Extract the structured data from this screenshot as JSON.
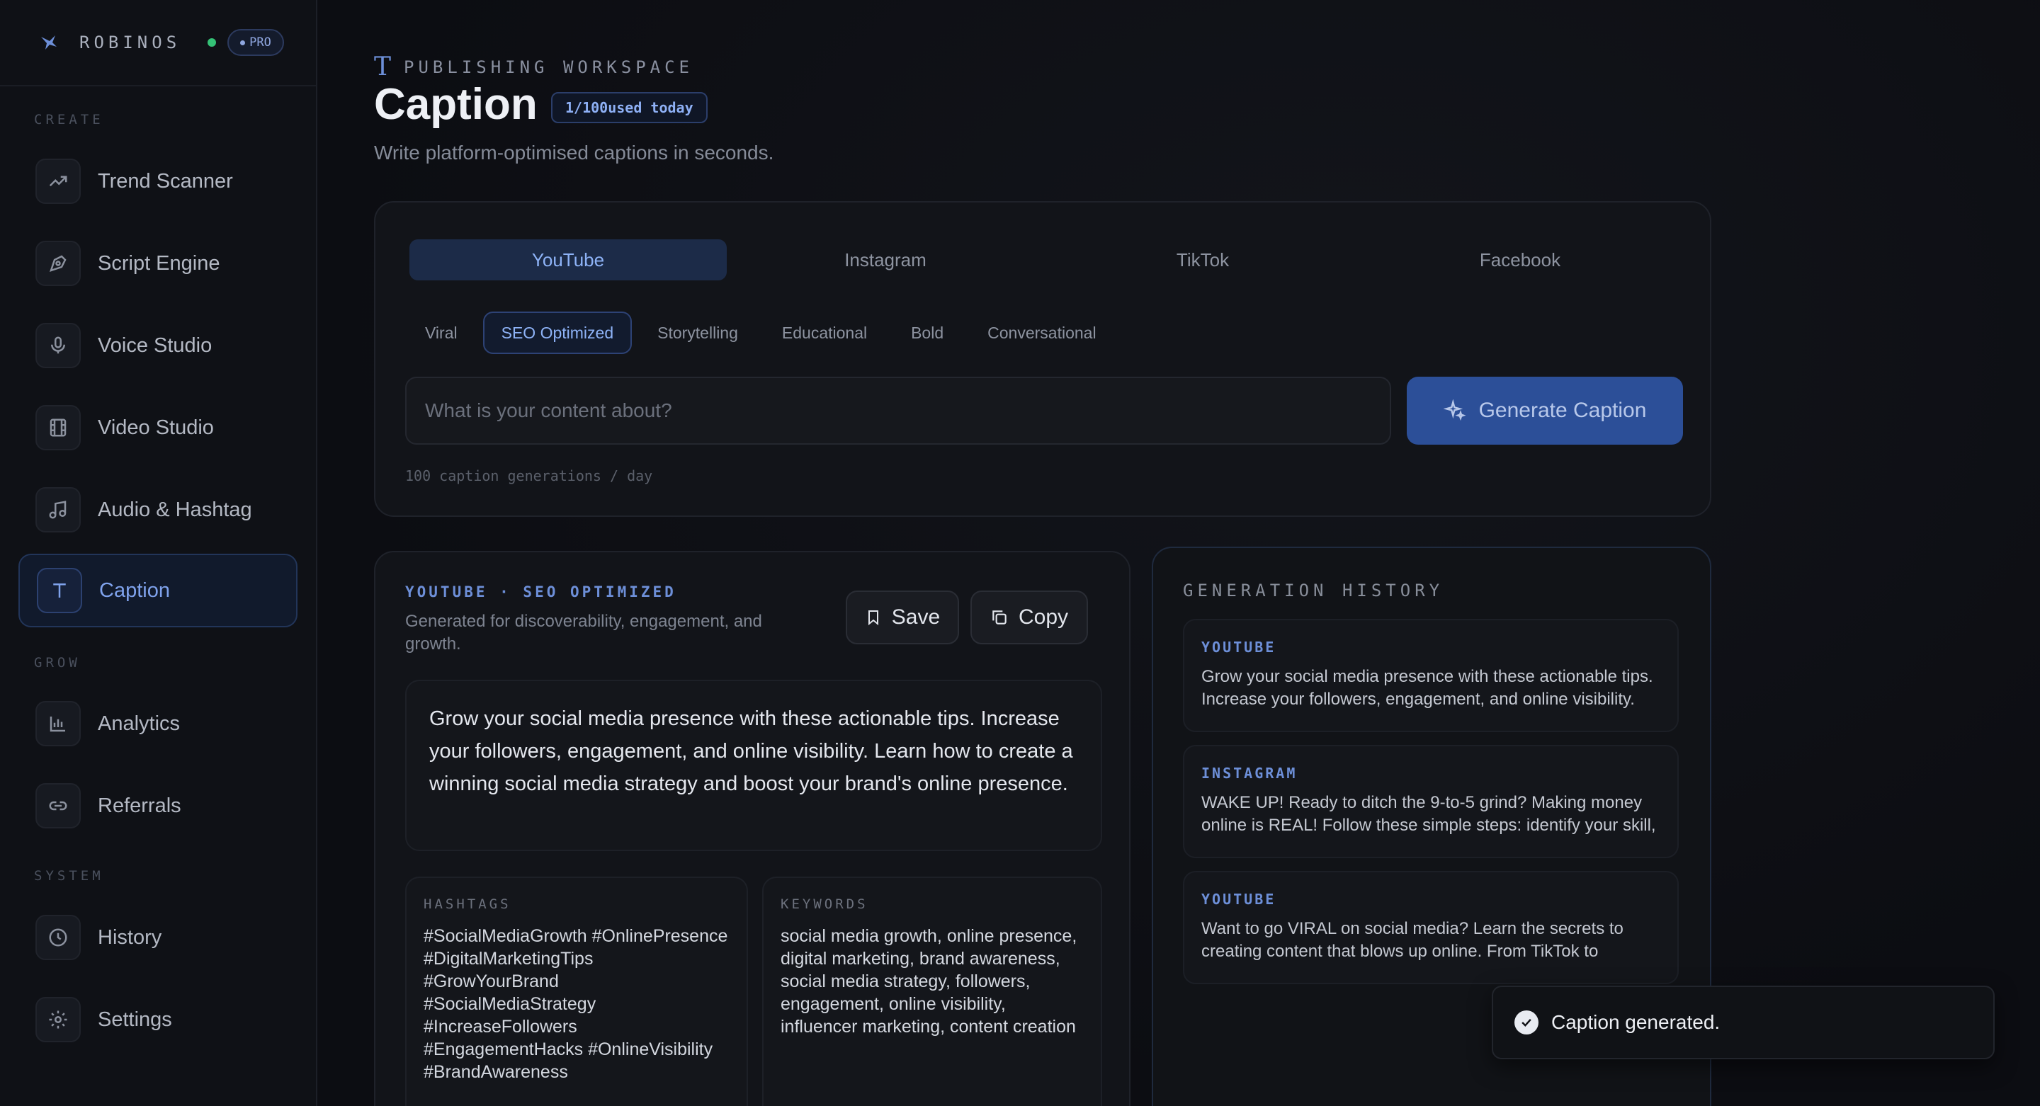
{
  "brand": {
    "name": "ROBINOS",
    "badge": "PRO"
  },
  "sidebar": {
    "sections": [
      {
        "label": "CREATE",
        "items": [
          {
            "label": "Trend Scanner",
            "icon": "trending-up-icon"
          },
          {
            "label": "Script Engine",
            "icon": "pen-nib-icon"
          },
          {
            "label": "Voice Studio",
            "icon": "microphone-icon"
          },
          {
            "label": "Video Studio",
            "icon": "film-icon"
          },
          {
            "label": "Audio & Hashtag",
            "icon": "music-note-icon"
          },
          {
            "label": "Caption",
            "icon": "text-t-icon",
            "active": true
          }
        ]
      },
      {
        "label": "GROW",
        "items": [
          {
            "label": "Analytics",
            "icon": "bar-chart-icon"
          },
          {
            "label": "Referrals",
            "icon": "link-icon"
          }
        ]
      },
      {
        "label": "SYSTEM",
        "items": [
          {
            "label": "History",
            "icon": "clock-icon"
          },
          {
            "label": "Settings",
            "icon": "gear-icon"
          }
        ]
      }
    ]
  },
  "header": {
    "eyebrow": "PUBLISHING WORKSPACE",
    "title": "Caption",
    "usage_badge": "1/100used today",
    "subtitle": "Write platform-optimised captions in seconds."
  },
  "composer": {
    "platforms": [
      "YouTube",
      "Instagram",
      "TikTok",
      "Facebook"
    ],
    "active_platform": "YouTube",
    "tones": [
      "Viral",
      "SEO Optimized",
      "Storytelling",
      "Educational",
      "Bold",
      "Conversational"
    ],
    "active_tone": "SEO Optimized",
    "input_placeholder": "What is your content about?",
    "input_value": "",
    "generate_label": "Generate Caption",
    "limit_note": "100 caption generations / day"
  },
  "result": {
    "tag": "YOUTUBE · SEO OPTIMIZED",
    "subtitle": "Generated for discoverability, engagement, and growth.",
    "save_label": "Save",
    "copy_label": "Copy",
    "caption": "Grow your social media presence with these actionable tips. Increase your followers, engagement, and online visibility. Learn how to create a winning social media strategy and boost your brand's online presence.",
    "hashtags_label": "HASHTAGS",
    "hashtags": "#SocialMediaGrowth #OnlinePresence #DigitalMarketingTips #GrowYourBrand #SocialMediaStrategy #IncreaseFollowers #EngagementHacks #OnlineVisibility #BrandAwareness",
    "keywords_label": "KEYWORDS",
    "keywords": "social media growth, online presence, digital marketing, brand awareness, social media strategy, followers, engagement, online visibility, influencer marketing, content creation"
  },
  "history": {
    "title": "GENERATION HISTORY",
    "items": [
      {
        "platform": "YOUTUBE",
        "text": "Grow your social media presence with these actionable tips. Increase your followers, engagement, and online visibility. Learn how to create a winning social media strategy."
      },
      {
        "platform": "INSTAGRAM",
        "text": "WAKE UP! Ready to ditch the 9-to-5 grind? Making money online is REAL! Follow these simple steps: identify your skill, find your niche, start selling it!"
      },
      {
        "platform": "YOUTUBE",
        "text": "Want to go VIRAL on social media? Learn the secrets to creating content that blows up online. From TikTok to Instagram, we break it down for you."
      }
    ]
  },
  "toast": {
    "message": "Caption generated."
  },
  "colors": {
    "accent": "#6d8fd8",
    "accent_strong": "#2c4f98",
    "success": "#34c276",
    "background": "#0c0d12"
  }
}
